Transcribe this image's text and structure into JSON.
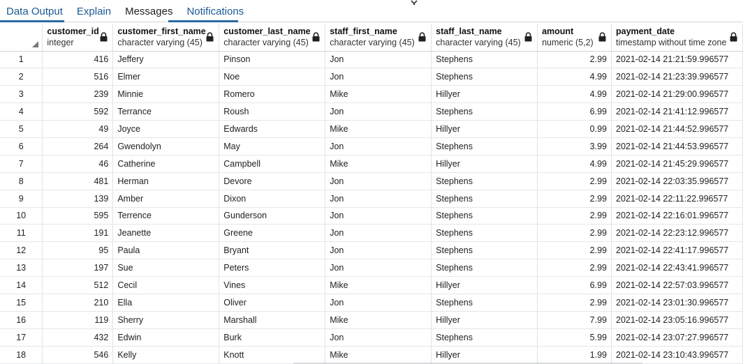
{
  "tabs": [
    {
      "label": "Data Output",
      "active": true
    },
    {
      "label": "Explain",
      "active": false
    },
    {
      "label": "Messages",
      "active": false
    },
    {
      "label": "Notifications",
      "active": true
    }
  ],
  "columns": [
    {
      "name": "customer_id",
      "type": "integer"
    },
    {
      "name": "customer_first_name",
      "type": "character varying (45)"
    },
    {
      "name": "customer_last_name",
      "type": "character varying (45)"
    },
    {
      "name": "staff_first_name",
      "type": "character varying (45)"
    },
    {
      "name": "staff_last_name",
      "type": "character varying (45)"
    },
    {
      "name": "amount",
      "type": "numeric (5,2)"
    },
    {
      "name": "payment_date",
      "type": "timestamp without time zone"
    }
  ],
  "rows": [
    [
      "1",
      "416",
      "Jeffery",
      "Pinson",
      "Jon",
      "Stephens",
      "2.99",
      "2021-02-14 21:21:59.996577"
    ],
    [
      "2",
      "516",
      "Elmer",
      "Noe",
      "Jon",
      "Stephens",
      "4.99",
      "2021-02-14 21:23:39.996577"
    ],
    [
      "3",
      "239",
      "Minnie",
      "Romero",
      "Mike",
      "Hillyer",
      "4.99",
      "2021-02-14 21:29:00.996577"
    ],
    [
      "4",
      "592",
      "Terrance",
      "Roush",
      "Jon",
      "Stephens",
      "6.99",
      "2021-02-14 21:41:12.996577"
    ],
    [
      "5",
      "49",
      "Joyce",
      "Edwards",
      "Mike",
      "Hillyer",
      "0.99",
      "2021-02-14 21:44:52.996577"
    ],
    [
      "6",
      "264",
      "Gwendolyn",
      "May",
      "Jon",
      "Stephens",
      "3.99",
      "2021-02-14 21:44:53.996577"
    ],
    [
      "7",
      "46",
      "Catherine",
      "Campbell",
      "Mike",
      "Hillyer",
      "4.99",
      "2021-02-14 21:45:29.996577"
    ],
    [
      "8",
      "481",
      "Herman",
      "Devore",
      "Jon",
      "Stephens",
      "2.99",
      "2021-02-14 22:03:35.996577"
    ],
    [
      "9",
      "139",
      "Amber",
      "Dixon",
      "Jon",
      "Stephens",
      "2.99",
      "2021-02-14 22:11:22.996577"
    ],
    [
      "10",
      "595",
      "Terrence",
      "Gunderson",
      "Jon",
      "Stephens",
      "2.99",
      "2021-02-14 22:16:01.996577"
    ],
    [
      "11",
      "191",
      "Jeanette",
      "Greene",
      "Jon",
      "Stephens",
      "2.99",
      "2021-02-14 22:23:12.996577"
    ],
    [
      "12",
      "95",
      "Paula",
      "Bryant",
      "Jon",
      "Stephens",
      "2.99",
      "2021-02-14 22:41:17.996577"
    ],
    [
      "13",
      "197",
      "Sue",
      "Peters",
      "Jon",
      "Stephens",
      "2.99",
      "2021-02-14 22:43:41.996577"
    ],
    [
      "14",
      "512",
      "Cecil",
      "Vines",
      "Mike",
      "Hillyer",
      "6.99",
      "2021-02-14 22:57:03.996577"
    ],
    [
      "15",
      "210",
      "Ella",
      "Oliver",
      "Jon",
      "Stephens",
      "2.99",
      "2021-02-14 23:01:30.996577"
    ],
    [
      "16",
      "119",
      "Sherry",
      "Marshall",
      "Mike",
      "Hillyer",
      "7.99",
      "2021-02-14 23:05:16.996577"
    ],
    [
      "17",
      "432",
      "Edwin",
      "Burk",
      "Jon",
      "Stephens",
      "5.99",
      "2021-02-14 23:07:27.996577"
    ],
    [
      "18",
      "546",
      "Kelly",
      "Knott",
      "Mike",
      "Hillyer",
      "1.99",
      "2021-02-14 23:10:43.996577"
    ]
  ],
  "icons": {
    "lock": "lock-icon",
    "corner": "select-all-triangle-icon",
    "splitter": "resize-handle-icon"
  },
  "colors": {
    "accent": "#2b6aa3",
    "link": "#1a5a96"
  }
}
